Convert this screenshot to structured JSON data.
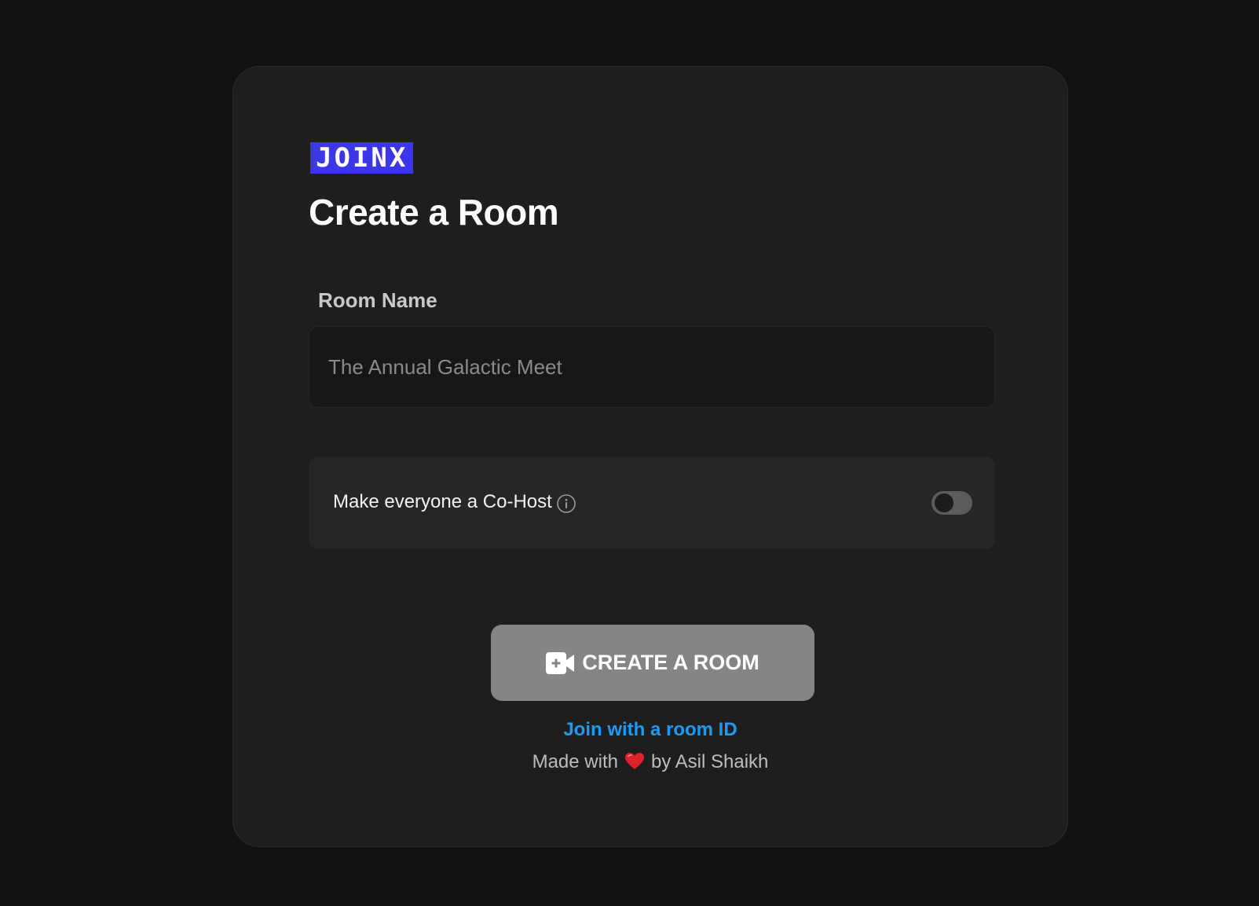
{
  "brand": {
    "logo_text": "JOINX",
    "logo_color": "#3b36e6"
  },
  "page": {
    "title": "Create a Room"
  },
  "room_form": {
    "name_label": "Room Name",
    "name_placeholder": "The Annual Galactic Meet",
    "name_value": ""
  },
  "cohost": {
    "label": "Make everyone a Co-Host",
    "info_icon": "info-icon",
    "enabled": false
  },
  "actions": {
    "create_icon": "video-plus-icon",
    "create_label": "CREATE A ROOM",
    "join_link": "Join with a room ID"
  },
  "footer": {
    "prefix": "Made with",
    "heart_icon": "heart-icon",
    "suffix": "by Asil Shaikh"
  },
  "colors": {
    "background": "#111111",
    "card": "#1e1e1e",
    "link": "#1e9bf0",
    "button": "#858585",
    "heart": "#e0212b"
  }
}
